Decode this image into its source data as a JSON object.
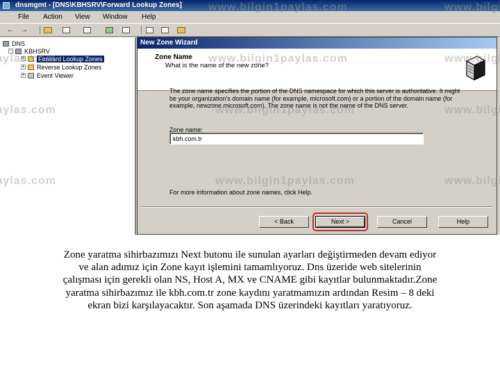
{
  "window": {
    "title": "dnsmgmt - [DNS\\KBHSRV\\Forward Lookup Zones]"
  },
  "menu": {
    "items": [
      "File",
      "Action",
      "View",
      "Window",
      "Help"
    ]
  },
  "toolbar": {
    "icons": [
      "back-arrow-icon",
      "forward-arrow-icon",
      "up-folder-icon",
      "show-tree-icon",
      "delete-icon",
      "properties-icon",
      "help-icon",
      "list-icon",
      "detail-icon",
      "new-zone-icon"
    ]
  },
  "tree": {
    "root": "DNS",
    "server": "KBHSRV",
    "children": [
      "Forward Lookup Zones",
      "Reverse Lookup Zones",
      "Event Viewer"
    ]
  },
  "wizard": {
    "title": "New Zone Wizard",
    "header_title": "Zone Name",
    "header_subtitle": "What is the name of the new zone?",
    "description": "The zone name specifies the portion of the DNS namespace for which this server is authoritative. It might be your organization's domain name (for example, microsoft.com) or a portion of the domain name (for example, newzone.microsoft.com). The zone name is not the name of the DNS server.",
    "field_label": "Zone name:",
    "field_value": "kbh.com.tr",
    "more_info": "For more information about zone names, click Help.",
    "buttons": {
      "back": "< Back",
      "next": "Next >",
      "cancel": "Cancel",
      "help": "Help"
    }
  },
  "watermark": "www.bilgin1paylas.com",
  "caption": "Zone yaratma sihirbazımızı Next butonu ile sunulan ayarları değiştirmeden devam ediyor ve alan adımız için Zone kayıt işlemini tamamlıyoruz. Dns üzeride web sitelerinin çalışması için gerekli olan NS, Host A, MX ve CNAME gibi kayıtlar bulunmaktadır.Zone yaratma sihirbazımız ile kbh.com.tr zone kaydını yaratmamızın ardından Resim – 8 deki ekran bizi karşılayacaktır. Son aşamada DNS üzerindeki kayıtları yaratıyoruz.",
  "colors": {
    "titlebar": "#0a246a",
    "window_face": "#d4d0c8",
    "highlight_ring": "#c0302a"
  }
}
